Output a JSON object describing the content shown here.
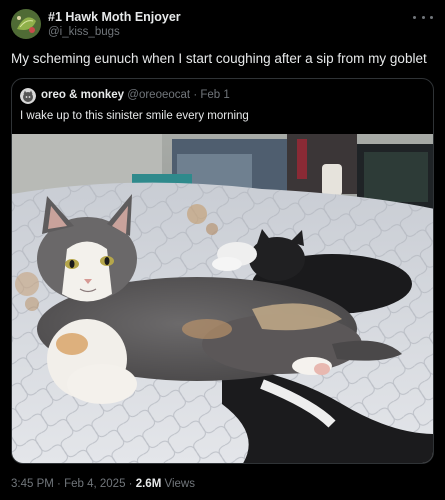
{
  "author": {
    "display_name": "#1 Hawk Moth Enjoyer",
    "handle": "@i_kiss_bugs",
    "avatar_icon": "green-leaf-avatar"
  },
  "tweet": {
    "text": "My scheming eunuch when I start coughing after a sip from my goblet"
  },
  "quoted": {
    "display_name": "oreo & monkey",
    "handle": "@oreoeocat",
    "separator": "·",
    "date": "Feb 1",
    "text": "I wake up to this sinister smile every morning",
    "image_alt": "calico cat lying on a quilted blanket next to a black and white cat"
  },
  "footer": {
    "time": "3:45 PM",
    "dot1": "·",
    "date": "Feb 4, 2025",
    "dot2": "·",
    "views_count": "2.6M",
    "views_label": "Views"
  },
  "colors": {
    "background": "#000000",
    "text_primary": "#e7e9ea",
    "text_secondary": "#71767b",
    "border": "#2f3336"
  }
}
